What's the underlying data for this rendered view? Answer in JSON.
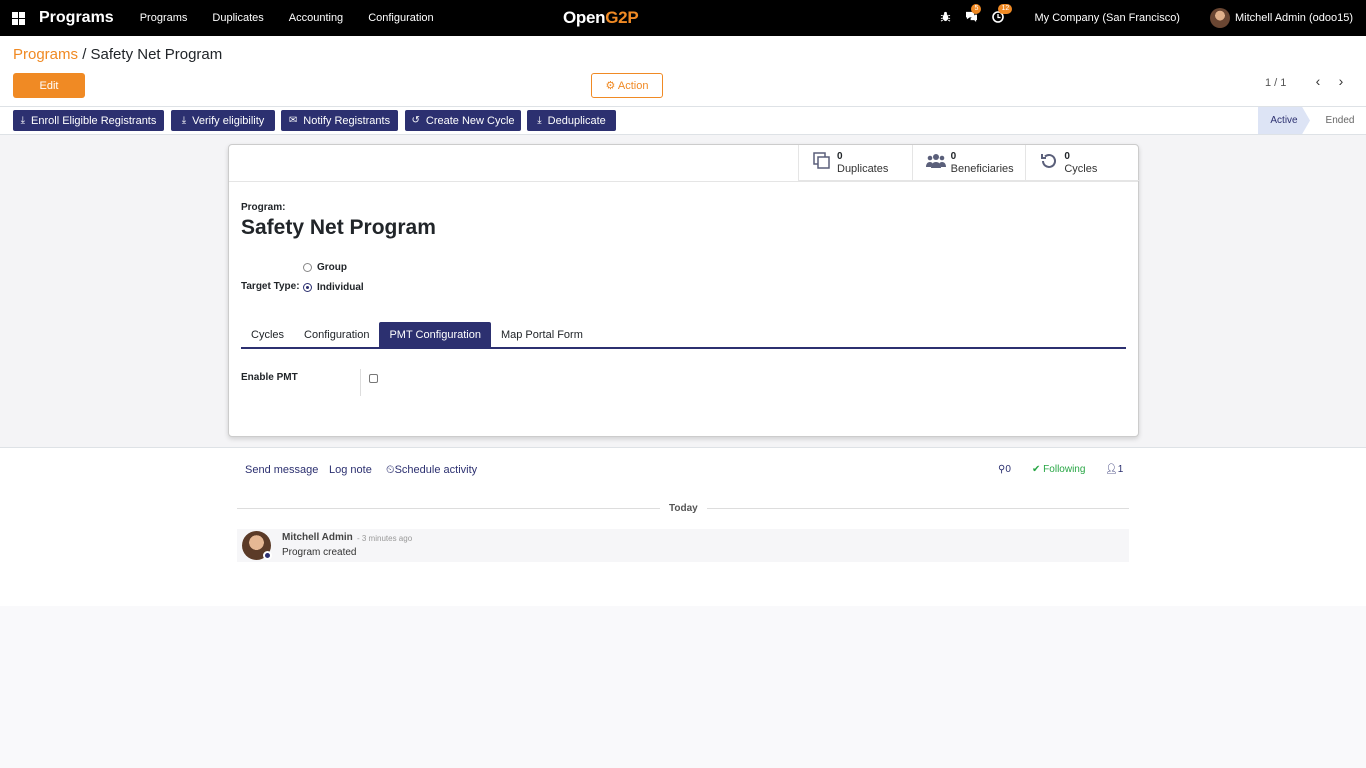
{
  "navbar": {
    "app_name": "Programs",
    "menu": [
      "Programs",
      "Duplicates",
      "Accounting",
      "Configuration"
    ],
    "logo_open": "Open",
    "logo_g2p": "G2P",
    "bug_icon": "bug-icon",
    "messages_badge": "5",
    "activities_badge": "12",
    "company": "My Company (San Francisco)",
    "user": "Mitchell Admin (odoo15)"
  },
  "breadcrumb": {
    "parent": "Programs",
    "separator": " / ",
    "current": "Safety Net Program"
  },
  "control": {
    "edit_label": "Edit",
    "action_label": "Action",
    "pager": "1 / 1"
  },
  "header_buttons": [
    {
      "label": "Enroll Eligible Registrants",
      "icon": "download-icon"
    },
    {
      "label": "Verify eligibility",
      "icon": "download-icon"
    },
    {
      "label": "Notify Registrants",
      "icon": "envelope-icon"
    },
    {
      "label": "Create New Cycle",
      "icon": "refresh-icon"
    },
    {
      "label": "Deduplicate",
      "icon": "download-icon"
    }
  ],
  "statusbar": {
    "active": "Active",
    "ended": "Ended"
  },
  "stat_buttons": [
    {
      "value": "0",
      "label": "Duplicates",
      "icon": "copy-icon"
    },
    {
      "value": "0",
      "label": "Beneficiaries",
      "icon": "users-icon"
    },
    {
      "value": "0",
      "label": "Cycles",
      "icon": "history-icon"
    }
  ],
  "form": {
    "program_label": "Program:",
    "program_name": "Safety Net Program",
    "target_type_label": "Target Type:",
    "target_options": [
      "Group",
      "Individual"
    ],
    "target_selected": "Individual",
    "tabs": [
      "Cycles",
      "Configuration",
      "PMT Configuration",
      "Map Portal Form"
    ],
    "active_tab": "PMT Configuration",
    "enable_pmt_label": "Enable PMT",
    "enable_pmt_value": false
  },
  "chatter": {
    "send_message": "Send message",
    "log_note": "Log note",
    "schedule_activity": "Schedule activity",
    "attachments": "0",
    "following": "Following",
    "followers": "1",
    "date_separator": "Today",
    "messages": [
      {
        "author": "Mitchell Admin",
        "time": "- 3 minutes ago",
        "body": "Program created"
      }
    ]
  },
  "colors": {
    "brand_orange": "#f08a24",
    "primary": "#2c3070",
    "following_green": "#28a745"
  }
}
